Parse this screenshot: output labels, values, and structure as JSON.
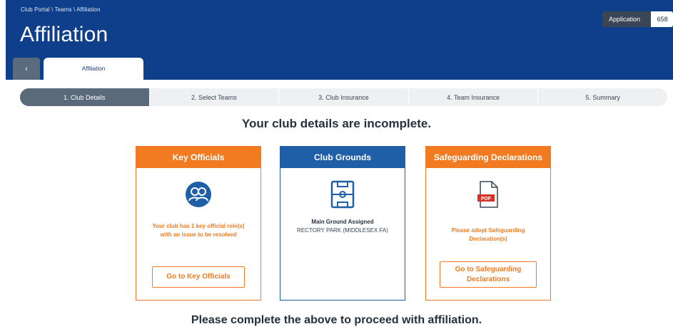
{
  "header": {
    "breadcrumb": "Club Portal \\ Teams \\ Affiliation",
    "title": "Affiliation",
    "application_id_label": "Application ID",
    "application_id_value": "658",
    "back_icon": "chevron-left-icon",
    "tab_label": "Affiliation"
  },
  "steps": [
    {
      "label": "1. Club Details",
      "active": true
    },
    {
      "label": "2. Select Teams",
      "active": false
    },
    {
      "label": "3. Club Insurance",
      "active": false
    },
    {
      "label": "4. Team Insurance",
      "active": false
    },
    {
      "label": "5. Summary",
      "active": false
    }
  ],
  "main": {
    "heading": "Your club details are incomplete.",
    "footer": "Please complete the above to proceed with affiliation."
  },
  "cards": {
    "key_officials": {
      "title": "Key Officials",
      "icon": "officials-icon",
      "message": "Your club has 1 key official role(s) with an issue to be resolved",
      "button": "Go to Key Officials"
    },
    "club_grounds": {
      "title": "Club Grounds",
      "icon": "pitch-icon",
      "label": "Main Ground Assigned",
      "value": "RECTORY PARK (MIDDLESEX FA)"
    },
    "safeguarding": {
      "title": "Safeguarding Declarations",
      "icon": "pdf-icon",
      "icon_text": "PDF",
      "message": "Please adopt Safeguarding Declaration(s)",
      "button": "Go to Safeguarding Declarations"
    }
  },
  "colors": {
    "header_blue": "#0f3f8b",
    "accent_orange": "#f27b21",
    "card_blue": "#1f5fa8",
    "active_step": "#5b6a7b"
  }
}
